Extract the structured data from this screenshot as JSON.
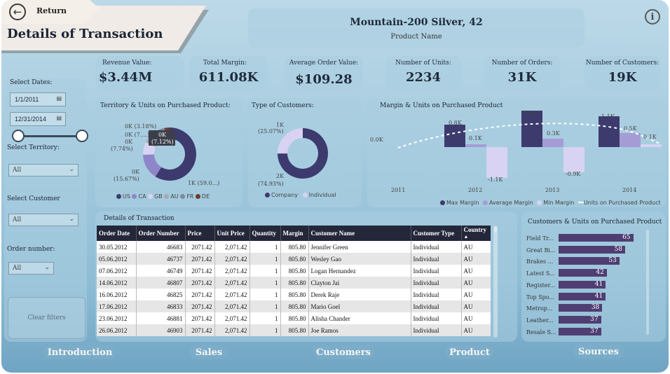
{
  "header": {
    "return_label": "Return",
    "title": "Details of Transaction",
    "product_name": "Mountain-200 Silver, 42",
    "product_sub": "Product Name"
  },
  "kpis": [
    {
      "label": "Revenue Value:",
      "value": "$3.44M"
    },
    {
      "label": "Total Margin:",
      "value": "611.08K"
    },
    {
      "label": "Average Order Value:",
      "value": "$109.28"
    },
    {
      "label": "Number of Units:",
      "value": "2234"
    },
    {
      "label": "Number of Orders:",
      "value": "31K"
    },
    {
      "label": "Number of Customers:",
      "value": "19K"
    }
  ],
  "filters": {
    "dates_label": "Select Dates:",
    "date_from": "1/1/2011",
    "date_to": "12/31/2014",
    "slider_from": 0,
    "slider_to": 1,
    "territory_label": "Select Territory:",
    "territory_value": "All",
    "customer_label": "Select Customer",
    "customer_value": "All",
    "order_label": "Order number:",
    "order_value": "All",
    "clear_label": "Clear filters"
  },
  "territory_chart": {
    "title": "Territory & Units on Purchased Product:",
    "labels": [
      "0K (3.18%)",
      "0K (7....)",
      "0K",
      "(7.74%)",
      "0K",
      "(7.12%)",
      "0K",
      "(15.67%)",
      "1K (59.0...)"
    ],
    "legend": [
      "US",
      "CA",
      "GB",
      "AU",
      "FR",
      "DE"
    ],
    "colors": {
      "US": "#3d3a6e",
      "CA": "#8f86c9",
      "GB": "#d8d3f2",
      "AU": "#a9a8b2",
      "FR": "#7d8aa0",
      "DE": "#6e3a2e"
    },
    "slices": [
      59.0,
      15.67,
      7.74,
      7.12,
      7.31,
      3.18
    ]
  },
  "customer_chart": {
    "title": "Type of Customers:",
    "labels": [
      "1K",
      "(25.07%)",
      "2K",
      "(74.93%)"
    ],
    "legend": [
      "Company",
      "Individual"
    ],
    "slices": [
      74.93,
      25.07
    ]
  },
  "margin_chart": {
    "title": "Margin & Units on Purchased Product",
    "years": [
      "2011",
      "2012",
      "2013",
      "2014"
    ],
    "max_margin": [
      0.0,
      0.8,
      1.3,
      1.1
    ],
    "avg_margin": [
      null,
      0.1,
      0.3,
      0.5
    ],
    "min_margin": [
      null,
      -1.1,
      -0.9,
      0.1
    ],
    "labels": [
      "0.0K",
      "0.8K",
      "0.1K",
      "-1.1K",
      "1.3K",
      "0.3K",
      "-0.9K",
      "1.1K",
      "0.5K",
      "0.1K"
    ],
    "legend": [
      "Max Margin",
      "Average Margin",
      "Min Margin",
      "Units on Purchased Product"
    ]
  },
  "table": {
    "title": "Details of Transaction",
    "columns": [
      "Order Date",
      "Order Number",
      "Price",
      "Unit Price",
      "Quantity",
      "Margin",
      "Customer Name",
      "Customer Type",
      "Country"
    ],
    "sort_indicator": "▲",
    "rows": [
      [
        "30.05.2012",
        "46683",
        "2071.42",
        "2,071.42",
        "1",
        "805.80",
        "Jennifer Green",
        "Individual",
        "AU"
      ],
      [
        "05.06.2012",
        "46737",
        "2071.42",
        "2,071.42",
        "1",
        "805.80",
        "Wesley Gao",
        "Individual",
        "AU"
      ],
      [
        "07.06.2012",
        "46749",
        "2071.42",
        "2,071.42",
        "1",
        "805.80",
        "Logan Hernandez",
        "Individual",
        "AU"
      ],
      [
        "14.06.2012",
        "46807",
        "2071.42",
        "2,071.42",
        "1",
        "805.80",
        "Clayton Jai",
        "Individual",
        "AU"
      ],
      [
        "16.06.2012",
        "46825",
        "2071.42",
        "2,071.42",
        "1",
        "805.80",
        "Derek Raje",
        "Individual",
        "AU"
      ],
      [
        "17.06.2012",
        "46833",
        "2071.42",
        "2,071.42",
        "1",
        "805.80",
        "Mario Goel",
        "Individual",
        "AU"
      ],
      [
        "23.06.2012",
        "46881",
        "2071.42",
        "2,071.42",
        "1",
        "805.80",
        "Alisha Chander",
        "Individual",
        "AU"
      ],
      [
        "26.06.2012",
        "46903",
        "2071.42",
        "2,071.42",
        "1",
        "805.80",
        "Joe Ramos",
        "Individual",
        "AU"
      ]
    ]
  },
  "customers_units": {
    "title": "Customers & Units on Purchased Product",
    "items": [
      {
        "label": "Field Tr...",
        "value": 65
      },
      {
        "label": "Great Bi...",
        "value": 58
      },
      {
        "label": "Brakes ...",
        "value": 53
      },
      {
        "label": "Latest S...",
        "value": 42
      },
      {
        "label": "Register...",
        "value": 41
      },
      {
        "label": "Top Spo...",
        "value": 41
      },
      {
        "label": "Metrop...",
        "value": 38
      },
      {
        "label": "Leather...",
        "value": 37
      },
      {
        "label": "Resale S...",
        "value": 37
      }
    ]
  },
  "nav": [
    "Introduction",
    "Sales",
    "Customers",
    "Product",
    "Sources"
  ],
  "icons": {
    "return": "arrow-left-icon",
    "info": "info-icon",
    "calendar": "calendar-icon",
    "dropdown": "chevron-down-icon"
  }
}
